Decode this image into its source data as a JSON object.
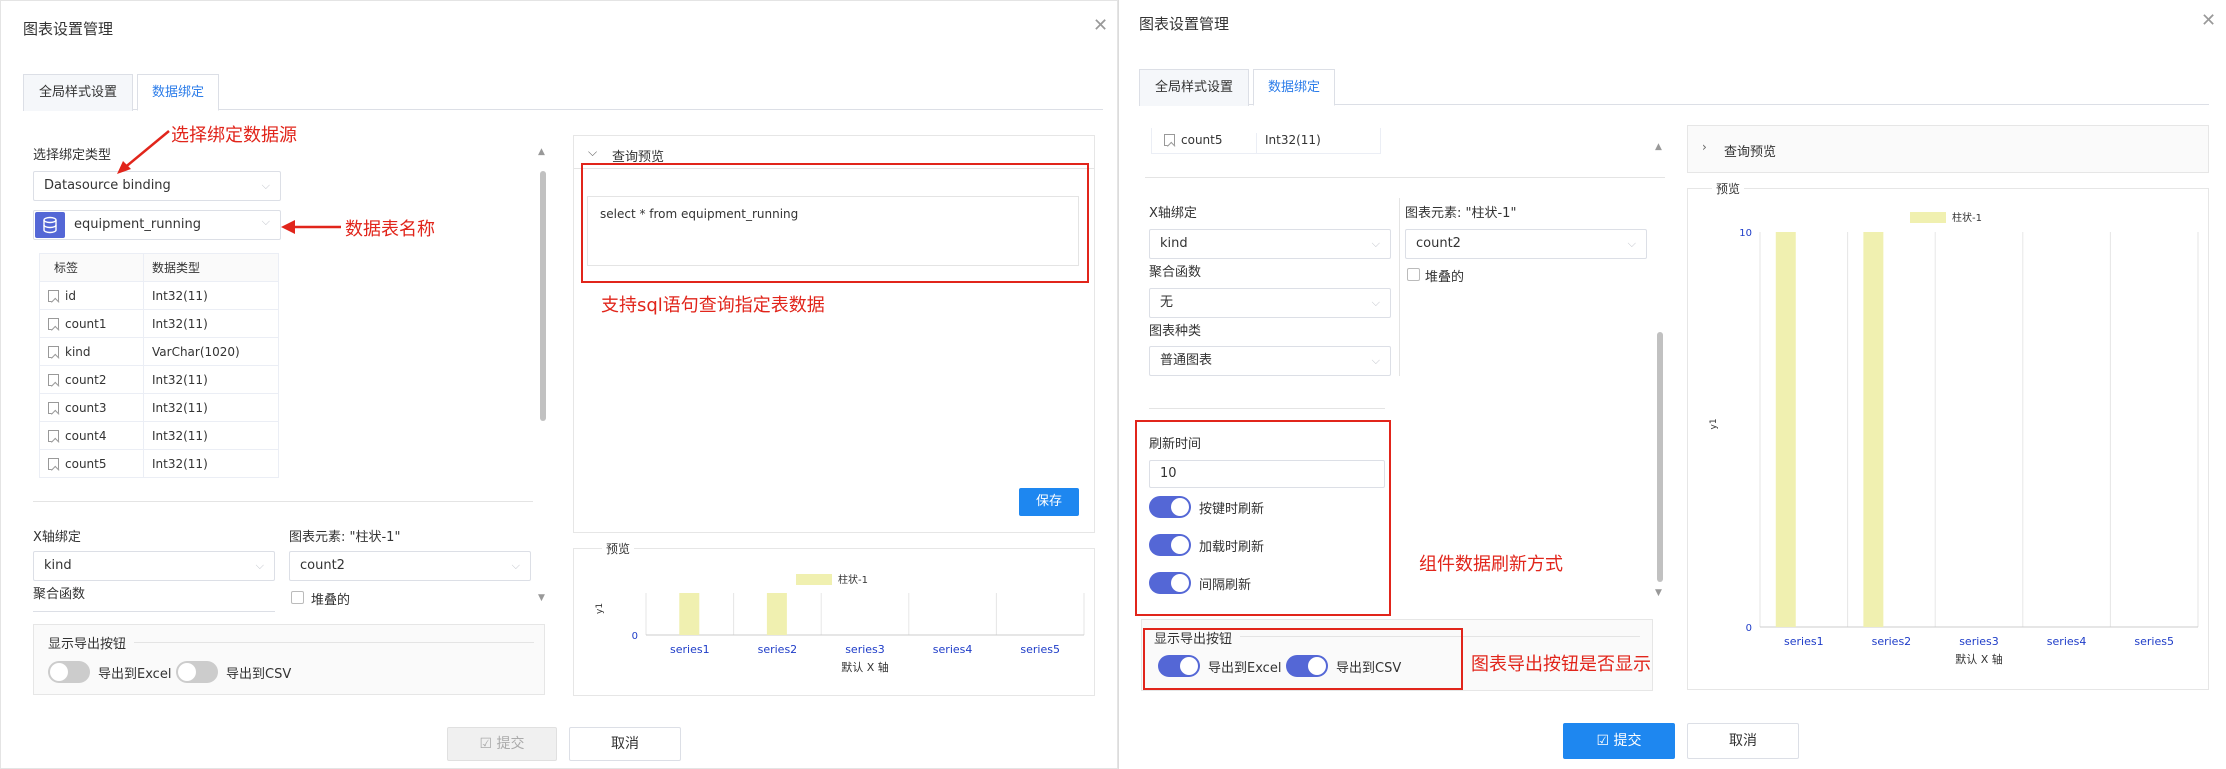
{
  "left": {
    "title": "图表设置管理",
    "tabs": [
      "全局样式设置",
      "数据绑定"
    ],
    "bind_type_label": "选择绑定类型",
    "bind_type_value": "Datasource binding",
    "table_name": "equipment_running",
    "fields_header": [
      "标签",
      "数据类型"
    ],
    "fields": [
      {
        "name": "id",
        "type": "Int32(11)"
      },
      {
        "name": "count1",
        "type": "Int32(11)"
      },
      {
        "name": "kind",
        "type": "VarChar(1020)"
      },
      {
        "name": "count2",
        "type": "Int32(11)"
      },
      {
        "name": "count3",
        "type": "Int32(11)"
      },
      {
        "name": "count4",
        "type": "Int32(11)"
      },
      {
        "name": "count5",
        "type": "Int32(11)"
      }
    ],
    "x_axis_label": "X轴绑定",
    "x_axis_value": "kind",
    "element_label": "图表元素: \"柱状-1\"",
    "element_value": "count2",
    "stacked_label": "堆叠的",
    "agg_label": "聚合函数",
    "export_label": "显示导出按钮",
    "export_excel": "导出到Excel",
    "export_csv": "导出到CSV",
    "query_preview_label": "查询预览",
    "sql": "select * from equipment_running",
    "save_label": "保存",
    "preview_label": "预览",
    "submit_label": "提交",
    "cancel_label": "取消",
    "annotations": {
      "datasource": "选择绑定数据源",
      "table": "数据表名称",
      "sql": "支持sql语句查询指定表数据"
    }
  },
  "right": {
    "title": "图表设置管理",
    "tabs": [
      "全局样式设置",
      "数据绑定"
    ],
    "top_field": {
      "name": "count5",
      "type": "Int32(11)"
    },
    "x_axis_label": "X轴绑定",
    "x_axis_value": "kind",
    "element_label": "图表元素: \"柱状-1\"",
    "element_value": "count2",
    "stacked_label": "堆叠的",
    "agg_label": "聚合函数",
    "agg_value": "无",
    "chart_kind_label": "图表种类",
    "chart_kind_value": "普通图表",
    "refresh_label": "刷新时间",
    "refresh_value": "10",
    "refresh_toggles": [
      "按键时刷新",
      "加载时刷新",
      "间隔刷新"
    ],
    "export_label": "显示导出按钮",
    "export_excel": "导出到Excel",
    "export_csv": "导出到CSV",
    "query_preview_label": "查询预览",
    "preview_label": "预览",
    "submit_label": "提交",
    "cancel_label": "取消",
    "annotations": {
      "refresh": "组件数据刷新方式",
      "export": "图表导出按钮是否显示"
    }
  },
  "colors": {
    "accent": "#1e87f0",
    "toggle_on": "#5467d6",
    "annotation": "#e1251b",
    "bar": "#f0f0b0"
  },
  "chart_data": [
    {
      "type": "bar",
      "legend": [
        "柱状-1"
      ],
      "categories": [
        "series1",
        "series2",
        "series3",
        "series4",
        "series5"
      ],
      "series": [
        {
          "name": "柱状-1",
          "values": [
            10,
            10,
            0,
            0,
            0
          ]
        }
      ],
      "ytick_labels": [
        "0"
      ],
      "xlabel": "默认 X 轴",
      "ylabel": "y1",
      "ylim": [
        0,
        10
      ]
    },
    {
      "type": "bar",
      "legend": [
        "柱状-1"
      ],
      "categories": [
        "series1",
        "series2",
        "series3",
        "series4",
        "series5"
      ],
      "series": [
        {
          "name": "柱状-1",
          "values": [
            10,
            10,
            0,
            0,
            0
          ]
        }
      ],
      "ytick_labels": [
        "10",
        "0"
      ],
      "xlabel": "默认 X 轴",
      "ylabel": "y1",
      "ylim": [
        0,
        10
      ]
    }
  ]
}
